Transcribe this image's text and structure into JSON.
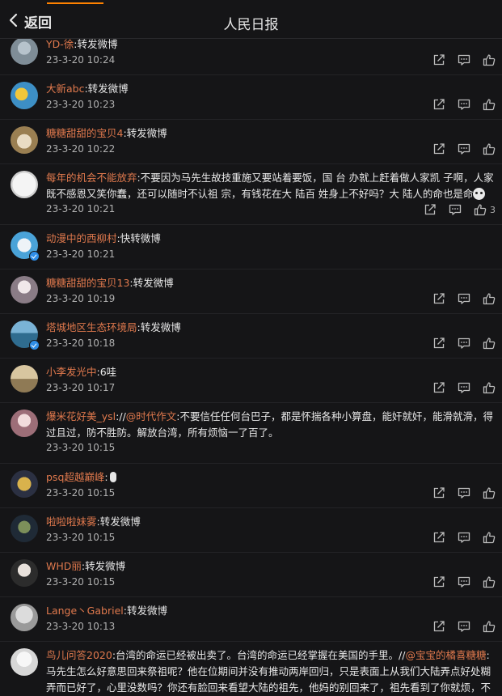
{
  "header": {
    "back_label": "返回",
    "title": "人民日报"
  },
  "colors": {
    "accent": "#ff8200",
    "username": "#e0794d",
    "background": "#151517"
  },
  "icons": {
    "share": "share-icon",
    "comment": "comment-icon",
    "like": "thumbs-up-icon"
  },
  "comments": [
    {
      "user": "YD-徐",
      "text": ":转发微博",
      "time": "23-3-20 10:24"
    },
    {
      "user": "大新abc",
      "text": ":转发微博",
      "time": "23-3-20 10:23"
    },
    {
      "user": "糖糖甜甜的宝贝4",
      "text": ":转发微博",
      "time": "23-3-20 10:22"
    },
    {
      "user": "每年的机会不能放弃",
      "text": ":不要因为马先生故技重施又要站着要饭，国 台 办就上赶着做人家凯 子啊，人家既不感恩又笑你蠢，还可以随时不认祖 宗，有钱花在大 陆百 姓身上不好吗？大 陆人的命也是命",
      "time": "23-3-20 10:21",
      "likes": "3"
    },
    {
      "user": "动漫中的西柳村",
      "text": ":快转微博",
      "time": "23-3-20 10:21"
    },
    {
      "user": "糖糖甜甜的宝贝13",
      "text": ":转发微博",
      "time": "23-3-20 10:19"
    },
    {
      "user": "塔城地区生态环境局",
      "text": ":转发微博",
      "time": "23-3-20 10:18"
    },
    {
      "user": "小李发光中",
      "text": ":6哇",
      "time": "23-3-20 10:17"
    },
    {
      "user": "爆米花好美_ysl",
      "text_pre": "://",
      "mention": "@时代作文",
      "text": ":不要信任任何台巴子，都是怀揣各种小算盘，能奸就奸，能滑就滑，得过且过，防不胜防。解放台湾，所有烦恼一了百了。",
      "time": "23-3-20 10:15"
    },
    {
      "user": "psq超越巅峰",
      "text": ":",
      "time": "23-3-20 10:15"
    },
    {
      "user": "啦啦啦妹雾",
      "text": ":转发微博",
      "time": "23-3-20 10:15"
    },
    {
      "user": "WHD丽",
      "text": ":转发微博",
      "time": "23-3-20 10:15"
    },
    {
      "user": "Lange丶Gabriel",
      "text": ":转发微博",
      "time": "23-3-20 10:13"
    },
    {
      "user": "鸟儿问答2020",
      "text": ":台湾的命运已经被出卖了。台湾的命运已经掌握在美国的手里。//",
      "mention": "@宝宝的橘喜糖糖",
      "text_post": ":马先生怎么好意思回来祭祖呢？他在位期间并没有推动两岸回归，只是表面上从我们大陆弄点好处糊弄而已好了，心里没数吗？你还有脸回来看望大陆的祖先，他妈的别回来了，祖先看到了你就烦，不肖子孙一个"
    }
  ]
}
